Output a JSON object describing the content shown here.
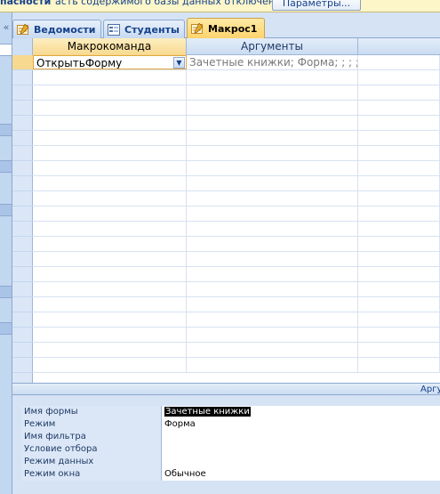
{
  "message_bar": {
    "bold_text": "пасности",
    "text": "асть содержимого базы данных отключено",
    "button_label": "Параметры..."
  },
  "nav_pane": {
    "collapse_glyph": "«"
  },
  "tabs": [
    {
      "label": "Ведомости",
      "icon": "query-icon",
      "active": false
    },
    {
      "label": "Студенты",
      "icon": "form-icon",
      "active": false
    },
    {
      "label": "Макрос1",
      "icon": "macro-icon",
      "active": true
    }
  ],
  "grid": {
    "columns": [
      "Макрокоманда",
      "Аргументы"
    ],
    "rows": [
      {
        "action": "ОткрытьФорму",
        "arguments": "Зачетные книжки; Форма; ; ; ;"
      }
    ],
    "empty_rows": 20
  },
  "properties": {
    "section_label": "Аргументы",
    "items": [
      {
        "label": "Имя формы",
        "value": "Зачетные книжки",
        "selected": true
      },
      {
        "label": "Режим",
        "value": "Форма"
      },
      {
        "label": "Имя фильтра",
        "value": ""
      },
      {
        "label": "Условие отбора",
        "value": ""
      },
      {
        "label": "Режим данных",
        "value": ""
      },
      {
        "label": "Режим окна",
        "value": "Обычное"
      }
    ]
  },
  "colors": {
    "active_tab": "#ffd36b",
    "ribbon_blue": "#d5e3f5",
    "selection": "#000000"
  }
}
